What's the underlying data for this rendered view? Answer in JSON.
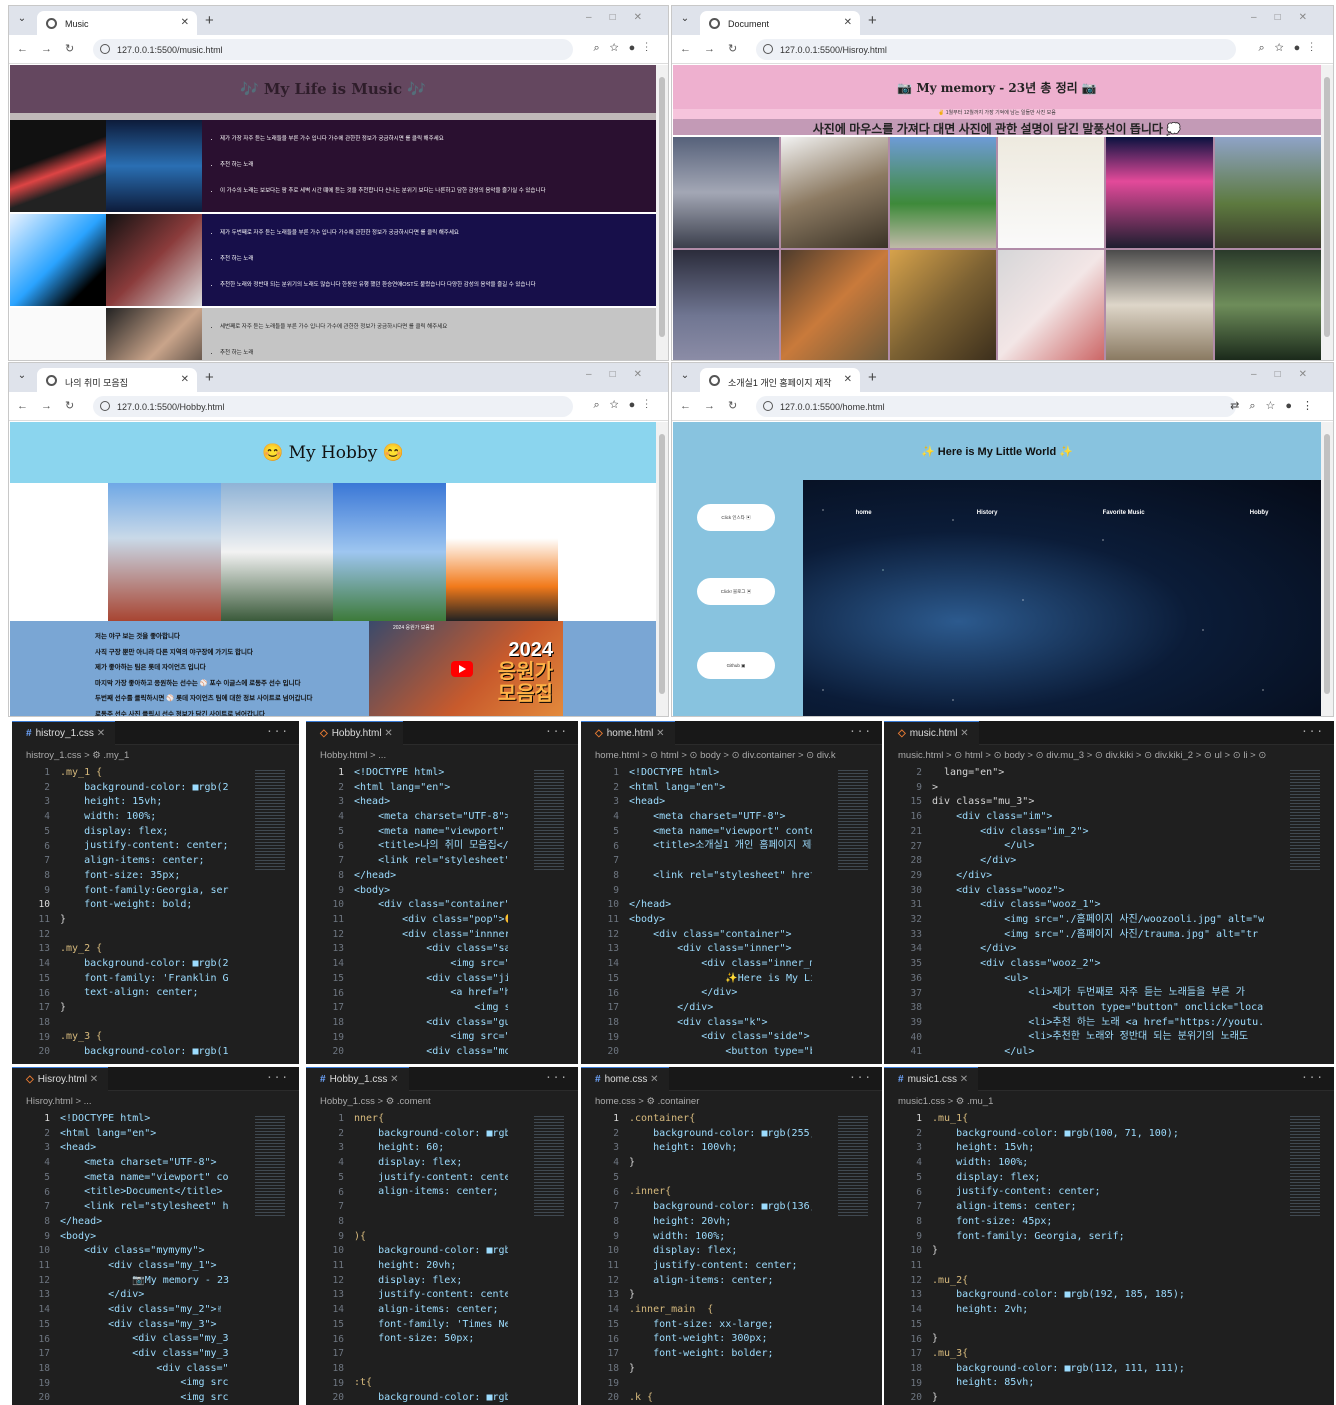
{
  "browsers": {
    "music": {
      "tab_title": "Music",
      "url": "127.0.0.1:5500/music.html",
      "page_title": "🎶 My Life is Music 🎶",
      "rows": [
        {
          "items": [
            "제가 가장 자주 듣는 노래들을 부른 가수 입니다 가수에 관한한 정보가 궁금하시면 를 클릭 해주세요",
            "추천 하는 노래",
            "이 가수의 노래는 보보다는 팜 추로 세벽 시간 떄에 듣는 것을 추천합니다 신나는 분위기 보다는 나른하고 담한 감성의 음악을 즐기실 수 있습니다"
          ]
        },
        {
          "items": [
            "제가 두번째로 자주 듣는 노래들을 부른 가수 입니다 가수에 관한한 정보가 궁금하시다면 를 클릭 해주세요",
            "추천 하는 노래",
            "추천한 노래와 정반대 되는 분위기의 노래도 많습니다 한동안 유행 했던 환승연애OST도 불렀습니다 다양한 감성의 음악을 즐길 수 있습니다"
          ]
        },
        {
          "items": [
            "세번째로 자주 듣는 노래들을 부른 가수 입니다 가수에 관한한 정보가 궁금하시다면 를 클릭 해주세요",
            "추천 하는 노래"
          ]
        }
      ]
    },
    "history": {
      "tab_title": "Document",
      "url": "127.0.0.1:5500/Hisroy.html",
      "page_title": "📷 My memory - 23년 총 정리 📷",
      "subtitle": "✌ 1월부터 12월까지 가장 기억에 남는 일들만 사진 모음",
      "caption": "사진에 마우스를 가져다 대면 사진에 관한 설명이 담긴 말풍선이 뜹니다 💭"
    },
    "hobby": {
      "tab_title": "나의 취미 모음집",
      "url": "127.0.0.1:5500/Hobby.html",
      "page_title": "😊 My Hobby 😊",
      "lines": [
        "저는 야구 보는 것을 좋아합니다",
        "사직 구장 뿐만 아니라 다른 지역의 야구장에 가기도 합니다",
        "제가 좋아하는 팀은 롯데 자이언츠 입니다",
        "마지막 가장 좋아하고 응원하는 선수는 ⚾ 포수 이글스에 로동주 선수 입니다",
        "두번째 선수를 클릭하시면 ⚾ 롯데 자이언츠 팀에 대한 정보 사이트로 넘어갑니다",
        "로동주 선수 사진 클릭시 선수 정보가 담긴 사이트로 넘어갑니다"
      ],
      "video_caption": "2024 응원가 모음집",
      "video_year": "2024",
      "video_text": "응원가",
      "video_text2": "모음집"
    },
    "home": {
      "tab_title": "소개실1 개인 홈페이지 제작",
      "url": "127.0.0.1:5500/home.html",
      "page_title": "✨ Here is My Little World ✨",
      "side_buttons": [
        "Click 인스타 ▣",
        "Click! 블로그 ▣",
        "Github ▣"
      ],
      "nav": [
        "home",
        "History",
        "Favorite Music",
        "Hobby"
      ]
    }
  },
  "editors": [
    {
      "tab": "histroy_1.css",
      "crumb": "histroy_1.css > ⚙ .my_1",
      "lines": [
        "1",
        "2",
        "3",
        "4",
        "5",
        "6",
        "7",
        "8",
        "9",
        "10",
        "11",
        "12",
        "13",
        "14",
        "15",
        "16",
        "17",
        "18",
        "19",
        "20"
      ],
      "current": "10"
    },
    {
      "tab": "Hobby.html",
      "crumb": "Hobby.html > ...",
      "lines": [
        "1",
        "2",
        "3",
        "4",
        "5",
        "6",
        "7",
        "8",
        "9",
        "10",
        "11",
        "12",
        "13",
        "14",
        "15",
        "16",
        "17",
        "18",
        "19",
        "20"
      ],
      "current": "1"
    },
    {
      "tab": "home.html",
      "crumb": "home.html > ⊙ html > ⊙ body > ⊙ div.container > ⊙ div.k",
      "lines": [
        "1",
        "2",
        "3",
        "4",
        "5",
        "6",
        "7",
        "8",
        "9",
        "10",
        "11",
        "12",
        "13",
        "14",
        "15",
        "16",
        "17",
        "18",
        "19",
        "20"
      ],
      "current": ""
    },
    {
      "tab": "music.html",
      "crumb": "music.html > ⊙ html > ⊙ body > ⊙ div.mu_3 > ⊙ div.kiki > ⊙ div.kiki_2 > ⊙ ul > ⊙ li > ⊙",
      "lines": [
        "2",
        "9",
        "15",
        "16",
        "21",
        "27",
        "28",
        "29",
        "30",
        "31",
        "32",
        "33",
        "34",
        "35",
        "36",
        "37",
        "38",
        "39",
        "40",
        "41"
      ],
      "current": ""
    },
    {
      "tab": "Hisroy.html",
      "crumb": "Hisroy.html > ...",
      "lines": [
        "1",
        "2",
        "3",
        "4",
        "5",
        "6",
        "7",
        "8",
        "9",
        "10",
        "11",
        "12",
        "13",
        "14",
        "15",
        "16",
        "17",
        "18",
        "19",
        "20"
      ],
      "current": "1"
    },
    {
      "tab": "Hobby_1.css",
      "crumb": "Hobby_1.css > ⚙ .coment",
      "lines": [
        "1",
        "2",
        "3",
        "4",
        "5",
        "6",
        "7",
        "8",
        "9",
        "10",
        "11",
        "12",
        "13",
        "14",
        "15",
        "16",
        "17",
        "18",
        "19",
        "20"
      ],
      "current": ""
    },
    {
      "tab": "home.css",
      "crumb": "home.css > ⚙ .container",
      "lines": [
        "1",
        "2",
        "3",
        "4",
        "5",
        "6",
        "7",
        "8",
        "9",
        "10",
        "11",
        "12",
        "13",
        "14",
        "15",
        "16",
        "17",
        "18",
        "19",
        "20"
      ],
      "current": "1"
    },
    {
      "tab": "music1.css",
      "crumb": "music1.css > ⚙ .mu_1",
      "lines": [
        "1",
        "2",
        "3",
        "4",
        "5",
        "6",
        "7",
        "8",
        "9",
        "10",
        "11",
        "12",
        "13",
        "14",
        "15",
        "16",
        "17",
        "18",
        "19",
        "20"
      ],
      "current": "1"
    }
  ],
  "code": [
    [
      ".my_1 {",
      "    background-color: ■rgb(235,",
      "    height: 15vh;",
      "    width: 100%;",
      "    display: flex;",
      "    justify-content: center;",
      "    align-items: center;",
      "    font-size: 35px;",
      "    font-family:Georgia, serif;",
      "    font-weight: bold;",
      "}",
      "",
      ".my_2 {",
      "    background-color: ■rgb(230,",
      "    font-family: 'Franklin Gothic",
      "    text-align: center;",
      "}",
      "",
      ".my_3 {",
      "    background-color: ■rgb(168,"
    ],
    [
      "<!DOCTYPE html>",
      "<html lang=\"en\">",
      "<head>",
      "    <meta charset=\"UTF-8\">",
      "    <meta name=\"viewport\" con",
      "    <title>나의 취미 모음집</t",
      "    <link rel=\"stylesheet\" hr",
      "</head>",
      "<body>",
      "    <div class=\"container\">",
      "        <div class=\"pop\">😊My",
      "        <div class=\"innner\">",
      "            <div class=\"sa\">",
      "                <img src=\"./홈",
      "            <div class=\"jic\">",
      "                <a href=\"http",
      "                    <img src=",
      "            <div class=\"gu\">",
      "                <img src=\"./홈",
      "            <div class=\"moon\">"
    ],
    [
      "<!DOCTYPE html>",
      "<html lang=\"en\">",
      "<head>",
      "    <meta charset=\"UTF-8\">",
      "    <meta name=\"viewport\" content=\"",
      "    <title>소개실1 개인 홈페이지 제작",
      "",
      "    <link rel=\"stylesheet\" href=\"ho",
      "",
      "</head>",
      "<body>",
      "    <div class=\"container\">",
      "        <div class=\"inner\">",
      "            <div class=\"inner_main\"",
      "                ✨Here is My Little",
      "            </div>",
      "        </div>",
      "        <div class=\"k\">",
      "            <div class=\"side\">",
      "                <button type=\"butto"
    ],
    [
      "  lang=\"en\">",
      ">",
      "div class=\"mu_3\">",
      "    <div class=\"im\">",
      "        <div class=\"im_2\">",
      "            </ul>",
      "        </div>",
      "    </div>",
      "    <div class=\"wooz\">",
      "        <div class=\"wooz_1\">",
      "            <img src=\"./홈페이지 사진/woozooli.jpg\" alt=\"w",
      "            <img src=\"./홈페이지 사진/trauma.jpg\" alt=\"tr",
      "        </div>",
      "        <div class=\"wooz_2\">",
      "            <ul>",
      "                <li>제가 두번째로 자주 듣는 노래들을 부른 가",
      "                    <button type=\"button\" onclick=\"locati",
      "                <li>추천 하는 노래 <a href=\"https://youtu.",
      "                <li>추천한 노래와 정반대 되는 분위기의 노래도",
      "            </ul>"
    ],
    [
      "<!DOCTYPE html>",
      "<html lang=\"en\">",
      "<head>",
      "    <meta charset=\"UTF-8\">",
      "    <meta name=\"viewport\" content",
      "    <title>Document</title>",
      "    <link rel=\"stylesheet\" href=\"",
      "</head>",
      "<body>",
      "    <div class=\"mymymy\">",
      "        <div class=\"my_1\">",
      "            📷My memory - 23년 총",
      "        </div>",
      "        <div class=\"my_2\">✌ 1월부",
      "        <div class=\"my_3\">",
      "            <div class=\"my_30\">사",
      "            <div class=\"my_3-1\">",
      "                <div class=\"my_31",
      "                    <img src=\"./홈",
      "                    <img src=\"./홈"
    ],
    [
      "nner{",
      "    background-color: ■rgb(238,",
      "    height: 60;",
      "    display: flex;",
      "    justify-content: center;",
      "    align-items: center;",
      "",
      "",
      "){",
      "    background-color: ■rgb(139,",
      "    height: 20vh;",
      "    display: flex;",
      "    justify-content: center;",
      "    align-items: center;",
      "    font-family: 'Times New Roman",
      "    font-size: 50px;",
      "",
      "",
      ":t{",
      "    background-color: ■rgb(122,"
    ],
    [
      ".container{",
      "    background-color: ■rgb(255, 25",
      "    height: 100vh;",
      "}",
      "",
      ".inner{",
      "    background-color: ■rgb(136, 19",
      "    height: 20vh;",
      "    width: 100%;",
      "    display: flex;",
      "    justify-content: center;",
      "    align-items: center;",
      "}",
      ".inner_main  {",
      "    font-size: xx-large;",
      "    font-weight: 300px;",
      "    font-weight: bolder;",
      "}",
      "",
      ".k {"
    ],
    [
      ".mu_1{",
      "    background-color: ■rgb(100, 71, 100);",
      "    height: 15vh;",
      "    width: 100%;",
      "    display: flex;",
      "    justify-content: center;",
      "    align-items: center;",
      "    font-size: 45px;",
      "    font-family: Georgia, serif;",
      "}",
      "",
      ".mu_2{",
      "    background-color: ■rgb(192, 185, 185);",
      "    height: 2vh;",
      "",
      "}",
      ".mu_3{",
      "    background-color: ■rgb(112, 111, 111);",
      "    height: 85vh;",
      "}"
    ]
  ],
  "colors": {
    "music_banner": "#64475f",
    "history_banner": "#eeb0cf",
    "hobby_banner": "#8bd5ee",
    "home_banner": "#88c3df",
    "editor_bg": "#1f1f1f"
  }
}
